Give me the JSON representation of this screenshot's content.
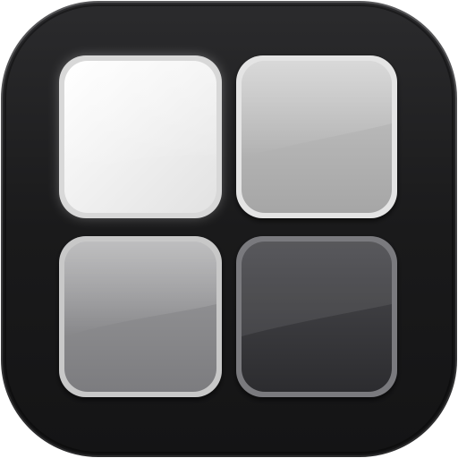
{
  "icon": {
    "name": "four-tile-grid-app-icon",
    "colors": {
      "background": "#1b1b1c",
      "background_edge": "#2e2e30",
      "tile_top_left": "#f2f2f2",
      "tile_top_right": "#b4b4b4",
      "tile_bottom_left": "#8e8e90",
      "tile_bottom_right": "#3a3a3d"
    },
    "tiles": [
      {
        "id": "tile-top-left",
        "tone": "white",
        "state": "glowing"
      },
      {
        "id": "tile-top-right",
        "tone": "light-gray",
        "state": "normal"
      },
      {
        "id": "tile-bottom-left",
        "tone": "mid-gray",
        "state": "normal"
      },
      {
        "id": "tile-bottom-right",
        "tone": "dark-gray",
        "state": "normal"
      }
    ]
  }
}
